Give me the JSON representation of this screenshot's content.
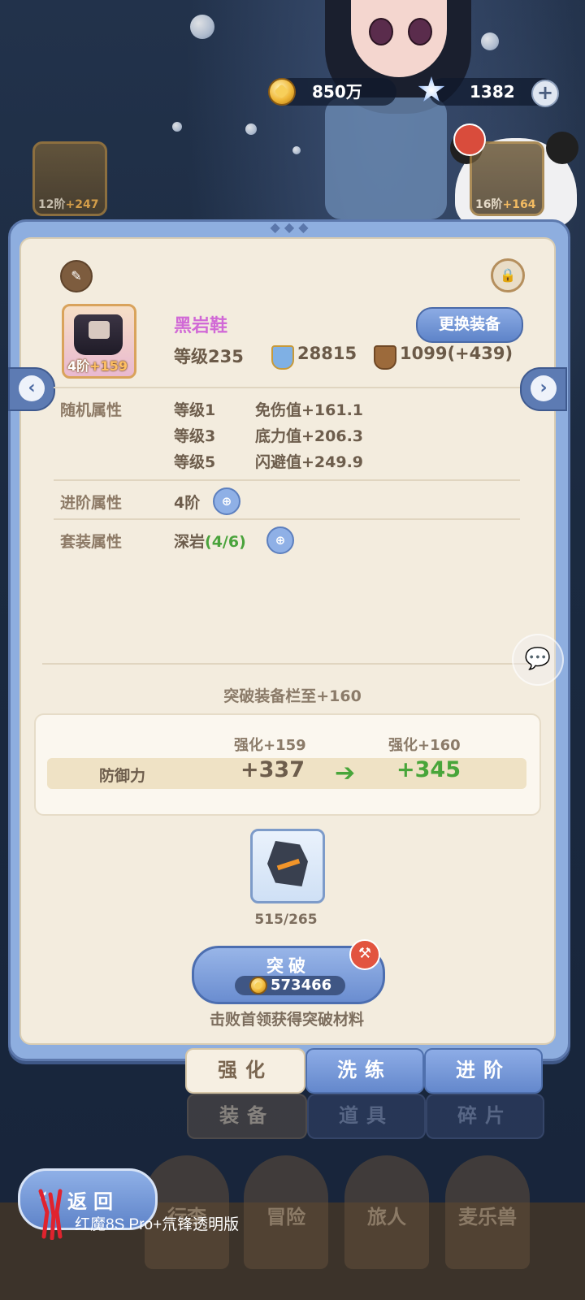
{
  "currency": {
    "gold": "850万",
    "gems": "1382"
  },
  "side_slots": {
    "left": {
      "tier": "12阶",
      "plus": "+247"
    },
    "right": {
      "tier": "16阶",
      "plus": "+164"
    }
  },
  "equipment": {
    "name": "黑岩鞋",
    "thumb_tier": "4阶",
    "thumb_plus": "+159",
    "change_button": "更换装备",
    "level": "等级235",
    "power": "28815",
    "defense": "1099(+439)"
  },
  "random_attrs": {
    "label": "随机属性",
    "rows": [
      {
        "level": "等级1",
        "effect": "免伤值+161.1"
      },
      {
        "level": "等级3",
        "effect": "底力值+206.3"
      },
      {
        "level": "等级5",
        "effect": "闪避值+249.9"
      }
    ]
  },
  "advance_attr": {
    "label": "进阶属性",
    "value": "4阶"
  },
  "set_attr": {
    "label": "套装属性",
    "name": "深岩",
    "progress": "(4/6)"
  },
  "breakthrough": {
    "title": "突破装备栏至+160",
    "col_old": "强化+159",
    "col_new": "强化+160",
    "attr_name": "防御力",
    "old_value": "+337",
    "new_value": "+345",
    "material_count": "515/265",
    "button_label": "突破",
    "cost": "573466",
    "hint": "击败首领获得突破材料"
  },
  "tabs_upper": [
    {
      "label": "强化"
    },
    {
      "label": "洗练"
    },
    {
      "label": "进阶"
    }
  ],
  "tabs_lower": [
    {
      "label": "装备"
    },
    {
      "label": "道具"
    },
    {
      "label": "碎片"
    }
  ],
  "bottom_nav": [
    {
      "label": "行李"
    },
    {
      "label": "冒险"
    },
    {
      "label": "旅人"
    },
    {
      "label": "麦乐兽"
    }
  ],
  "back_button": "返回",
  "watermark": "红魔8S Pro+氘锋透明版",
  "colors": {
    "accent_blue": "#6a8dd0",
    "panel_bg": "#f3ecde",
    "name_purple": "#d169d6",
    "increase_green": "#48a53a"
  }
}
